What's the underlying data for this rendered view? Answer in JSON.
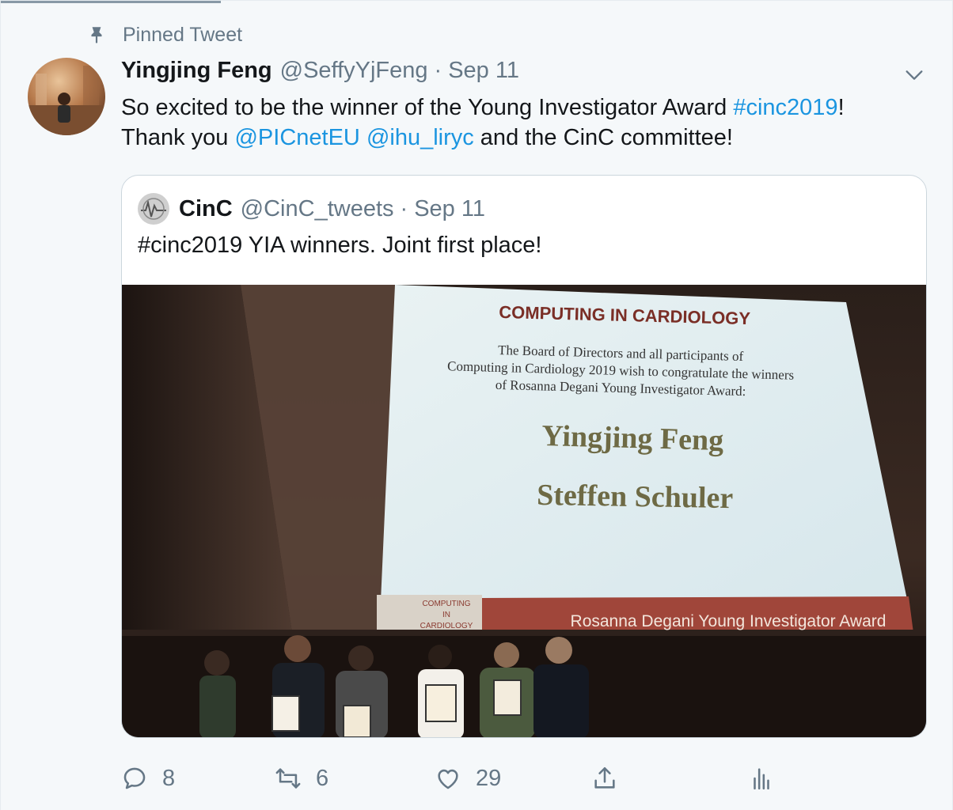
{
  "pinned": {
    "label": "Pinned Tweet",
    "icon": "pin-icon"
  },
  "tweet": {
    "display_name": "Yingjing Feng",
    "handle": "@SeffyYjFeng",
    "dot": "·",
    "time": "Sep 11",
    "text": {
      "line1_pre": "So excited to be the winner of the Young Investigator Award ",
      "hashtag": "#cinc2019",
      "line1_post": "!",
      "line2_pre": "Thank you ",
      "mention1": "@PICnetEU",
      "mention2": "@ihu_liryc",
      "line2_post": " and the CinC committee!"
    }
  },
  "quote": {
    "display_name": "CinC",
    "handle": "@CinC_tweets",
    "dot": "·",
    "time": "Sep 11",
    "text": "#cinc2019 YIA winners. Joint first place!",
    "media": {
      "slide_title": "COMPUTING IN CARDIOLOGY",
      "slide_body_1": "The Board of Directors and all participants of",
      "slide_body_2": "Computing in Cardiology 2019 wish to congratulate the winners",
      "slide_body_3": "of Rosanna Degani Young Investigator Award:",
      "winner_1": "Yingjing Feng",
      "winner_2": "Steffen Schuler",
      "footer_logo_1": "COMPUTING",
      "footer_logo_2": "IN",
      "footer_logo_3": "CARDIOLOGY",
      "footer_banner": "Rosanna Degani Young Investigator Award"
    }
  },
  "actions": {
    "reply_count": "8",
    "retweet_count": "6",
    "like_count": "29"
  },
  "colors": {
    "link": "#1b95e0",
    "muted": "#657786",
    "text": "#14171a"
  }
}
